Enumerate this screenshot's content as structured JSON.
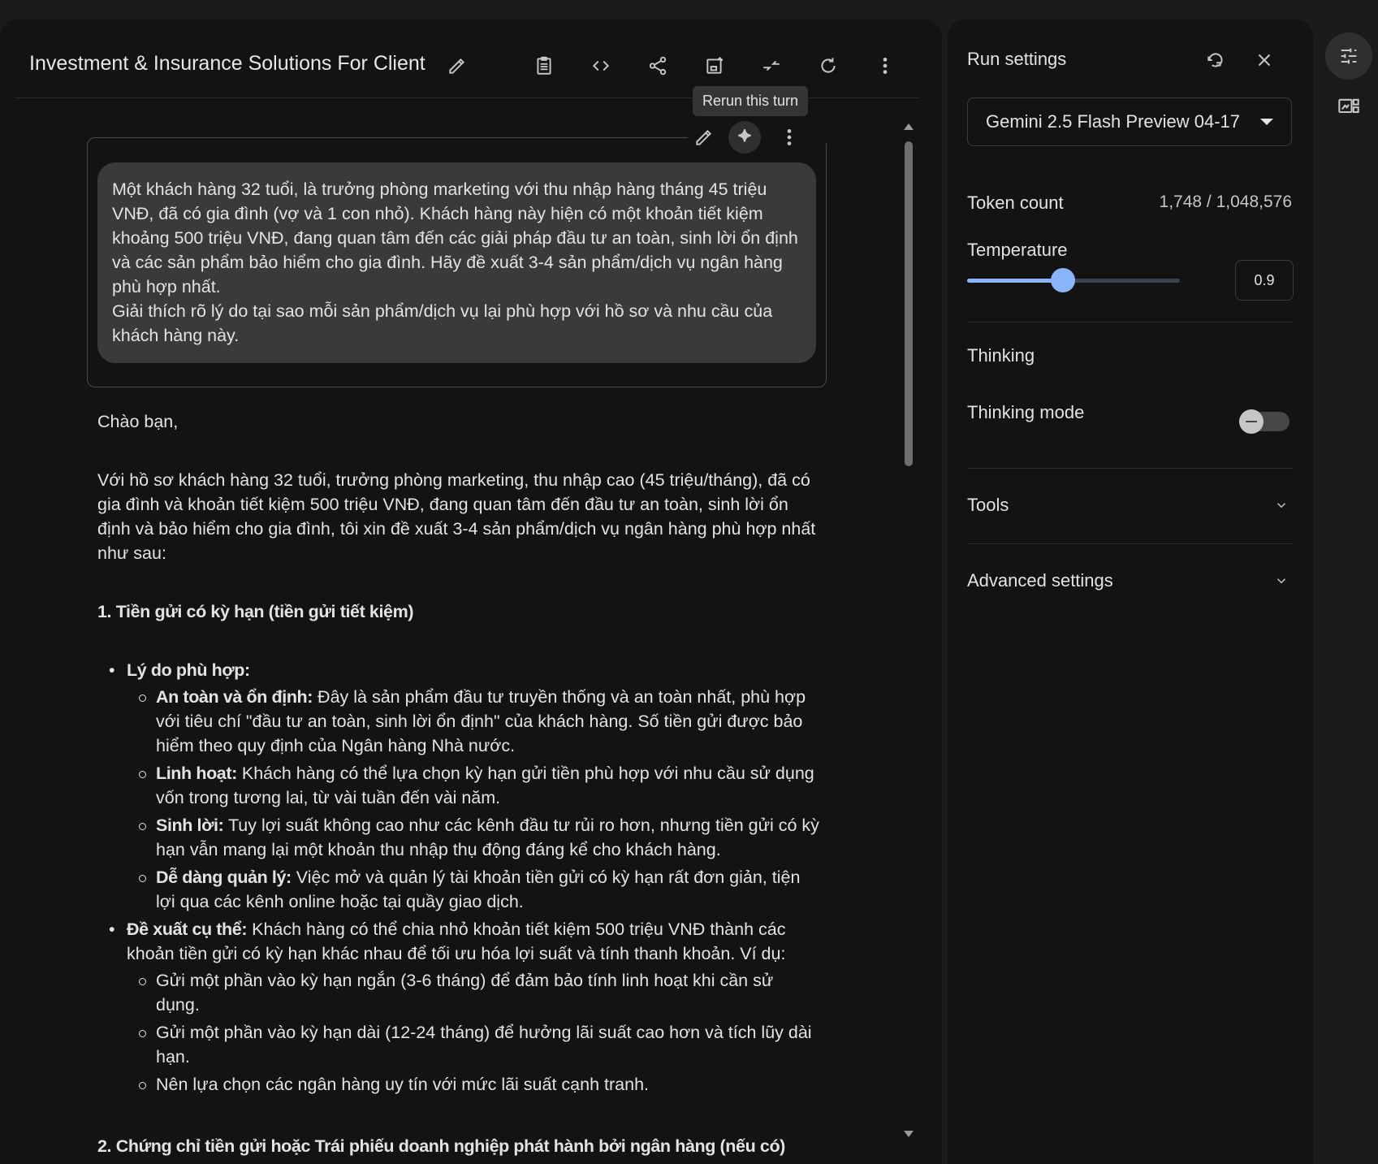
{
  "header": {
    "title": "Investment & Insurance Solutions For Client",
    "tooltip": "Rerun this turn"
  },
  "user_turn": {
    "text": "Một khách hàng 32 tuổi, là trưởng phòng marketing với thu nhập hàng tháng 45 triệu VNĐ, đã có gia đình (vợ và 1 con nhỏ). Khách hàng này hiện có một khoản tiết kiệm khoảng 500 triệu VNĐ, đang quan tâm đến các giải pháp đầu tư an toàn, sinh lời ổn định và các sản phẩm bảo hiểm cho gia đình. Hãy đề xuất 3-4 sản phẩm/dịch vụ ngân hàng phù hợp nhất.\nGiải thích rõ lý do tại sao mỗi sản phẩm/dịch vụ lại phù hợp với hồ sơ và nhu cầu của khách hàng này."
  },
  "response": {
    "greeting": "Chào bạn,",
    "intro": "Với hồ sơ khách hàng 32 tuổi, trưởng phòng marketing, thu nhập cao (45 triệu/tháng), đã có gia đình và khoản tiết kiệm 500 triệu VNĐ, đang quan tâm đến đầu tư an toàn, sinh lời ổn định và bảo hiểm cho gia đình, tôi xin đề xuất 3-4 sản phẩm/dịch vụ ngân hàng phù hợp nhất như sau:",
    "section1_title": "1. Tiền gửi có kỳ hạn (tiền gửi tiết kiệm)",
    "reason_label": "Lý do phù hợp:",
    "reasons": [
      {
        "label": "An toàn và ổn định:",
        "text": " Đây là sản phẩm đầu tư truyền thống và an toàn nhất, phù hợp với tiêu chí \"đầu tư an toàn, sinh lời ổn định\" của khách hàng. Số tiền gửi được bảo hiểm theo quy định của Ngân hàng Nhà nước."
      },
      {
        "label": "Linh hoạt:",
        "text": " Khách hàng có thể lựa chọn kỳ hạn gửi tiền phù hợp với nhu cầu sử dụng vốn trong tương lai, từ vài tuần đến vài năm."
      },
      {
        "label": "Sinh lời:",
        "text": " Tuy lợi suất không cao như các kênh đầu tư rủi ro hơn, nhưng tiền gửi có kỳ hạn vẫn mang lại một khoản thu nhập thụ động đáng kể cho khách hàng."
      },
      {
        "label": "Dễ dàng quản lý:",
        "text": " Việc mở và quản lý tài khoản tiền gửi có kỳ hạn rất đơn giản, tiện lợi qua các kênh online hoặc tại quầy giao dịch."
      }
    ],
    "proposal_label": "Đề xuất cụ thể:",
    "proposal_text": " Khách hàng có thể chia nhỏ khoản tiết kiệm 500 triệu VNĐ thành các khoản tiền gửi có kỳ hạn khác nhau để tối ưu hóa lợi suất và tính thanh khoản. Ví dụ:",
    "proposals": [
      "Gửi một phần vào kỳ hạn ngắn (3-6 tháng) để đảm bảo tính linh hoạt khi cần sử dụng.",
      "Gửi một phần vào kỳ hạn dài (12-24 tháng) để hưởng lãi suất cao hơn và tích lũy dài hạn.",
      "Nên lựa chọn các ngân hàng uy tín với mức lãi suất cạnh tranh."
    ],
    "section2_title": "2. Chứng chỉ tiền gửi hoặc Trái phiếu doanh nghiệp phát hành bởi ngân hàng (nếu có)"
  },
  "run_settings": {
    "title": "Run settings",
    "model": "Gemini 2.5 Flash Preview 04-17",
    "token_label": "Token count",
    "token_value": "1,748 / 1,048,576",
    "temperature_label": "Temperature",
    "temperature_value": "0.9",
    "temperature_fraction": 0.45,
    "thinking_heading": "Thinking",
    "thinking_mode_label": "Thinking mode",
    "thinking_mode_on": false,
    "tools_label": "Tools",
    "advanced_label": "Advanced settings"
  },
  "colors": {
    "accent": "#8ab4f8",
    "background": "#131313",
    "bubble": "#3a3a3a"
  }
}
